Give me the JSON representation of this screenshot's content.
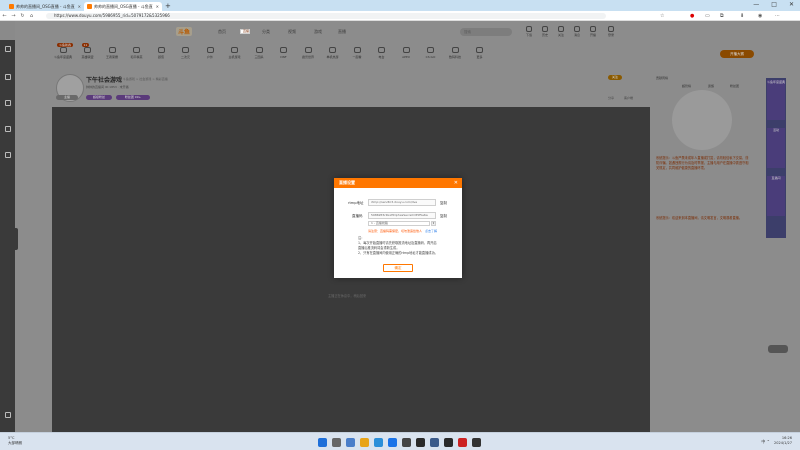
{
  "browser": {
    "tabs": [
      {
        "label": "帅帅的直播间_OSG直播 - 斗鱼直",
        "active": false
      },
      {
        "label": "帅帅的直播间_OSG直播 - 斗鱼直",
        "active": true
      }
    ],
    "new_tab": "+",
    "window_controls": [
      "—",
      "□",
      "✕"
    ],
    "url": "https://www.douyu.com/5986955_rid=5079172&5325966"
  },
  "site": {
    "logo": "斗鱼",
    "nav": [
      "首页",
      "直播",
      "分类",
      "视频",
      "游戏",
      "直播"
    ],
    "nav_selected": 1,
    "search_placeholder": "搜索",
    "header_icons": [
      "下载",
      "历史",
      "关注",
      "消息",
      "开播",
      "登录"
    ],
    "categories": [
      {
        "label": "斗鱼年度盛典",
        "badge": "斗鱼新春"
      },
      {
        "label": "英雄联盟",
        "badge": "11"
      },
      {
        "label": "王者荣耀",
        "badge": ""
      },
      {
        "label": "和平精英",
        "badge": ""
      },
      {
        "label": "颜值",
        "badge": ""
      },
      {
        "label": "二次元",
        "badge": ""
      },
      {
        "label": "户外",
        "badge": ""
      },
      {
        "label": "主机游戏",
        "badge": ""
      },
      {
        "label": "三国杀",
        "badge": ""
      },
      {
        "label": "DNF",
        "badge": ""
      },
      {
        "label": "魔兽世界",
        "badge": ""
      },
      {
        "label": "单机热游",
        "badge": ""
      },
      {
        "label": "一起看",
        "badge": ""
      },
      {
        "label": "电台",
        "badge": ""
      },
      {
        "label": "APEX",
        "badge": ""
      },
      {
        "label": "CS:GO",
        "badge": ""
      },
      {
        "label": "数码科技",
        "badge": ""
      },
      {
        "label": "更多",
        "badge": ""
      }
    ],
    "open_live": "开播大赛"
  },
  "room": {
    "title": "下午社会游戏",
    "subtitle": "举报 · 斗鱼游戏 > 社会游戏 > 精彩直播",
    "meta": "帅帅的直播间  ID:1853  · 未开播",
    "tags": [
      "主播",
      "超级粉丝",
      "粉丝团 99+"
    ],
    "actions": [
      "分享",
      "客户端"
    ],
    "pill": "关注"
  },
  "right_panel": {
    "tabs": [
      "贡献周榜",
      "超管榜",
      "贵族",
      "粉丝团"
    ],
    "text1": "系统提示：斗鱼严禁未成年人直播或打赏，请勿轻信私下交易，谨防诈骗。如遇违规行为请及时举报，主播与用户在直播中需遵守相关规定，共同维护健康的直播环境。",
    "text2": "系统提示：欢迎来到本直播间，请文明发言，文明观看直播。"
  },
  "ads": [
    "斗鱼年度盛典",
    "活动",
    "直播间"
  ],
  "player_hint": "主播正在休息中，稍后回来",
  "dialog": {
    "title": "直播设置",
    "close": "✕",
    "rtmp_label": "rtmp地址",
    "rtmp_value": "rtmp://sendtc3.douyu.com/live",
    "stream_label": "直播码",
    "stream_value": "5986955rRLxHDp?wsSecret=85f5e6a",
    "copy_label": "复制",
    "select_value": "1 - 直播线路",
    "warning": "请注意：直播码需保密，切勿泄露给他人",
    "warning_link": "点击了解",
    "notes": [
      "注：",
      "1、每次开始直播时请先获取推流地址及直播码，再开启",
      "直播后推流码将会重新生成。",
      "2、只有在直播间内使用正确的rtmp地址才能直播成功。"
    ],
    "ok": "确定"
  },
  "taskbar": {
    "weather": "5°C",
    "weather_desc": "大部晴朗",
    "tray": "中 ⌃",
    "time": "16:26",
    "date": "2024/1/27"
  },
  "colors": {
    "accent": "#ff7700",
    "dim_overlay": "#8c8c8c",
    "player_bg": "#3a3a3a",
    "link": "#2b7de9"
  }
}
